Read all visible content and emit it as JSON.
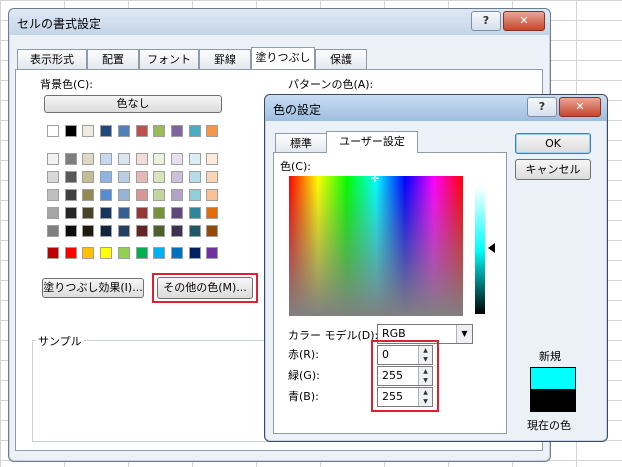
{
  "format_dialog": {
    "title": "セルの書式設定",
    "help": "?",
    "close": "✕",
    "tabs": [
      "表示形式",
      "配置",
      "フォント",
      "罫線",
      "塗りつぶし",
      "保護"
    ],
    "active_tab": "塗りつぶし",
    "background_color_label": "背景色(C):",
    "no_color_button": "色なし",
    "pattern_color_label": "パターンの色(A):",
    "fill_effects_button": "塗りつぶし効果(I)...",
    "more_colors_button": "その他の色(M)...",
    "sample_label": "サンプル",
    "palette_top": [
      "#ffffff",
      "#000000",
      "#eeece1",
      "#1f497d",
      "#4f81bd",
      "#c0504d",
      "#9bbb59",
      "#8064a2",
      "#4bacc6",
      "#f79646"
    ],
    "palette_shades": [
      [
        "#f2f2f2",
        "#7f7f7f",
        "#ddd9c3",
        "#c6d9f0",
        "#dbe5f1",
        "#f2dcdb",
        "#ebf1dd",
        "#e5e0ec",
        "#dbeef3",
        "#fdeada"
      ],
      [
        "#d8d8d8",
        "#595959",
        "#c4bd97",
        "#8db3e2",
        "#b8cce4",
        "#e5b9b7",
        "#d7e3bc",
        "#ccc1d9",
        "#b7dde8",
        "#fbd5b5"
      ],
      [
        "#bfbfbf",
        "#3f3f3f",
        "#938953",
        "#548dd4",
        "#95b3d7",
        "#d99694",
        "#c3d69b",
        "#b2a2c7",
        "#92cddc",
        "#fac08f"
      ],
      [
        "#a5a5a5",
        "#262626",
        "#494429",
        "#17365d",
        "#366092",
        "#953734",
        "#76923c",
        "#5f497a",
        "#31859b",
        "#e36c09"
      ],
      [
        "#7f7f7f",
        "#0c0c0c",
        "#1d1b10",
        "#0f243e",
        "#244061",
        "#632423",
        "#4f6128",
        "#3f3151",
        "#205867",
        "#974806"
      ]
    ],
    "palette_standard": [
      "#c00000",
      "#ff0000",
      "#ffc000",
      "#ffff00",
      "#92d050",
      "#00b050",
      "#00b0f0",
      "#0070c0",
      "#002060",
      "#7030a0"
    ]
  },
  "color_dialog": {
    "title": "色の設定",
    "help": "?",
    "close": "✕",
    "tabs": [
      "標準",
      "ユーザー設定"
    ],
    "active_tab": "ユーザー設定",
    "color_label": "色(C):",
    "ok_button": "OK",
    "cancel_button": "キャンセル",
    "color_model_label": "カラー モデル(D):",
    "color_model_value": "RGB",
    "red_label": "赤(R):",
    "green_label": "緑(G):",
    "blue_label": "青(B):",
    "red_value": "0",
    "green_value": "255",
    "blue_value": "255",
    "new_label": "新規",
    "current_label": "現在の色",
    "new_color": "#00ffff",
    "current_color": "#000000"
  }
}
